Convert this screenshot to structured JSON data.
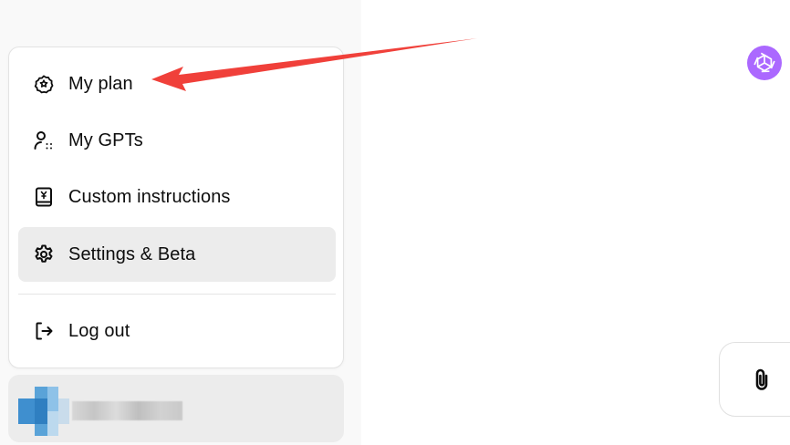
{
  "menu": {
    "items": [
      {
        "label": "My plan",
        "icon": "plan-badge-icon"
      },
      {
        "label": "My GPTs",
        "icon": "gpts-icon"
      },
      {
        "label": "Custom instructions",
        "icon": "custom-instructions-icon"
      },
      {
        "label": "Settings & Beta",
        "icon": "settings-gear-icon",
        "active": true
      },
      {
        "label": "Log out",
        "icon": "log-out-icon"
      }
    ]
  },
  "user": {
    "avatar": "avatar-blurred",
    "name_blurred": true
  },
  "colors": {
    "sidebar_bg": "#f9f9f9",
    "menu_bg": "#ffffff",
    "active_bg": "#ececec",
    "annotation_arrow": "#f0403a",
    "brand_logo_bg": "#ab68ff"
  },
  "icons": {
    "brand": "openai-logo-icon",
    "attach": "paperclip-icon"
  }
}
